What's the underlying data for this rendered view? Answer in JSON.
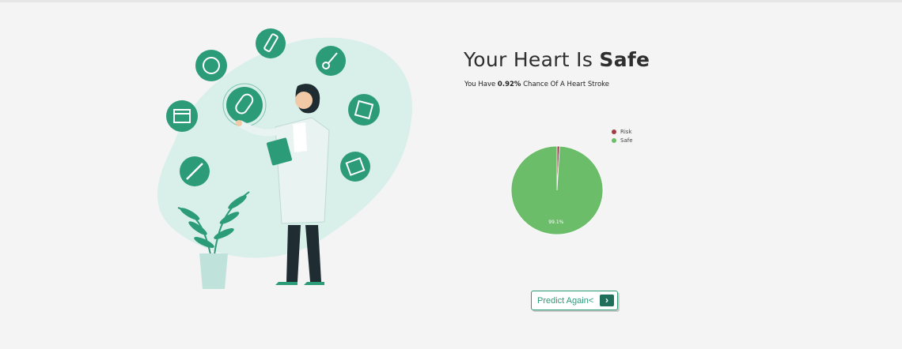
{
  "result": {
    "title_prefix": "Your Heart Is ",
    "title_status": "Safe",
    "subtitle_prefix": "You Have ",
    "subtitle_percent": "0.92%",
    "subtitle_suffix": " Chance Of A Heart Stroke"
  },
  "chart_data": {
    "type": "pie",
    "labels": [
      "Risk",
      "Safe"
    ],
    "values": [
      0.92,
      99.08
    ],
    "colors": [
      "#a23b45",
      "#6cbd6a"
    ],
    "data_labels": [
      "",
      "99.1%"
    ],
    "legend_position": "top-right"
  },
  "actions": {
    "predict_again_label": "Predict Again<",
    "arrow_icon": "chevron-right-icon",
    "arrow_glyph": "›"
  },
  "illustration": {
    "description_icons": [
      "syringe-icon",
      "pill-icon",
      "scissors-icon",
      "calendar-icon",
      "bandage-icon",
      "capsule-icon",
      "thermometer-icon",
      "tablets-icon"
    ]
  },
  "colors": {
    "accent": "#2c9b78",
    "accent_dark": "#1f6f5a",
    "background": "#f4f4f4",
    "blob": "#d9efea"
  }
}
